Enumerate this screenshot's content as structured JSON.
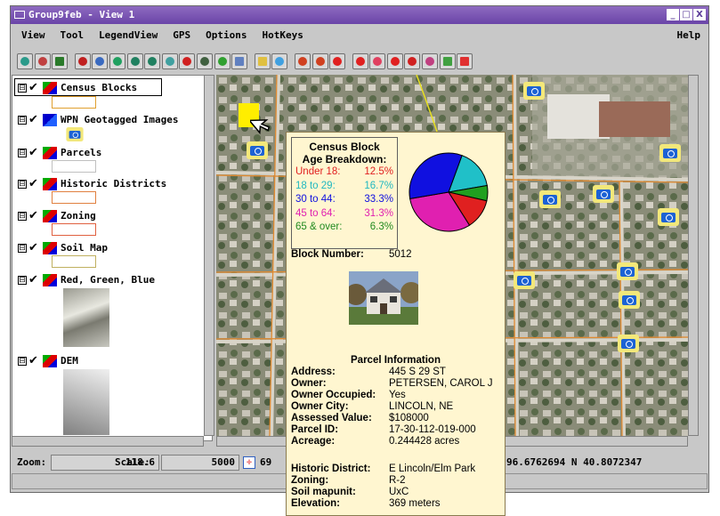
{
  "window": {
    "title": "Group9feb - View 1",
    "buttons": [
      "_",
      "□",
      "X"
    ]
  },
  "menu": {
    "items": [
      "View",
      "Tool",
      "LegendView",
      "GPS",
      "Options",
      "HotKeys"
    ],
    "help": "Help"
  },
  "legend": {
    "layers": [
      {
        "name": "Census Blocks",
        "expand": "⊟",
        "checked": "✔"
      },
      {
        "name": "WPN Geotagged Images",
        "expand": "⊟",
        "checked": "✔"
      },
      {
        "name": "Parcels",
        "expand": "⊟",
        "checked": "✔"
      },
      {
        "name": "Historic Districts",
        "expand": "⊟",
        "checked": "✔"
      },
      {
        "name": "Zoning",
        "expand": "⊟",
        "checked": "✔"
      },
      {
        "name": "Soil Map",
        "expand": "⊟",
        "checked": "✔"
      },
      {
        "name": "Red, Green, Blue",
        "expand": "⊟",
        "checked": "✔"
      },
      {
        "name": "DEM",
        "expand": "⊟",
        "checked": "✔"
      }
    ]
  },
  "status": {
    "zoom_label": "Zoom:",
    "zoom_value": "118.6",
    "scale_label": "Scale:",
    "scale_value": "5000",
    "coord_partial": "69",
    "coordinates": "96.6762694  N 40.8072347"
  },
  "popup": {
    "census_title_1": "Census Block",
    "census_title_2": "Age Breakdown:",
    "age_groups": [
      {
        "label": "Under 18:",
        "value": "12.5%",
        "pct": 12.5,
        "color": "#e02020"
      },
      {
        "label": "18 to 29:",
        "value": "16.7%",
        "pct": 16.7,
        "color": "#20c0c8"
      },
      {
        "label": "30 to 44:",
        "value": "33.3%",
        "pct": 33.3,
        "color": "#1010e0"
      },
      {
        "label": "45 to 64:",
        "value": "31.3%",
        "pct": 31.3,
        "color": "#e020b0"
      },
      {
        "label": "65 & over:",
        "value": "6.3%",
        "pct": 6.3,
        "color": "#20a020"
      }
    ],
    "block_label": "Block Number:",
    "block_value": "5012",
    "parcel_title": "Parcel Information",
    "parcel_fields": [
      {
        "k": "Address:",
        "v": "445 S 29 ST"
      },
      {
        "k": "Owner:",
        "v": "PETERSEN, CAROL J"
      },
      {
        "k": "Owner Occupied:",
        "v": "Yes"
      },
      {
        "k": "Owner City:",
        "v": "LINCOLN, NE"
      },
      {
        "k": "Assessed Value:",
        "v": "$108000"
      },
      {
        "k": "Parcel ID:",
        "v": "17-30-112-019-000"
      },
      {
        "k": "Acreage:",
        "v": "0.244428 acres"
      }
    ],
    "other_fields": [
      {
        "k": "Historic District:",
        "v": "E Lincoln/Elm Park"
      },
      {
        "k": "Zoning:",
        "v": "R-2"
      },
      {
        "k": "Soil mapunit:",
        "v": "UxC"
      },
      {
        "k": "Elevation:",
        "v": "369 meters"
      }
    ]
  },
  "colors": {
    "title_bar": "#6a44a8",
    "popup_bg": "#fff6d0",
    "camera_icon": "#1c62d4",
    "selected_block": "#ffee00"
  }
}
